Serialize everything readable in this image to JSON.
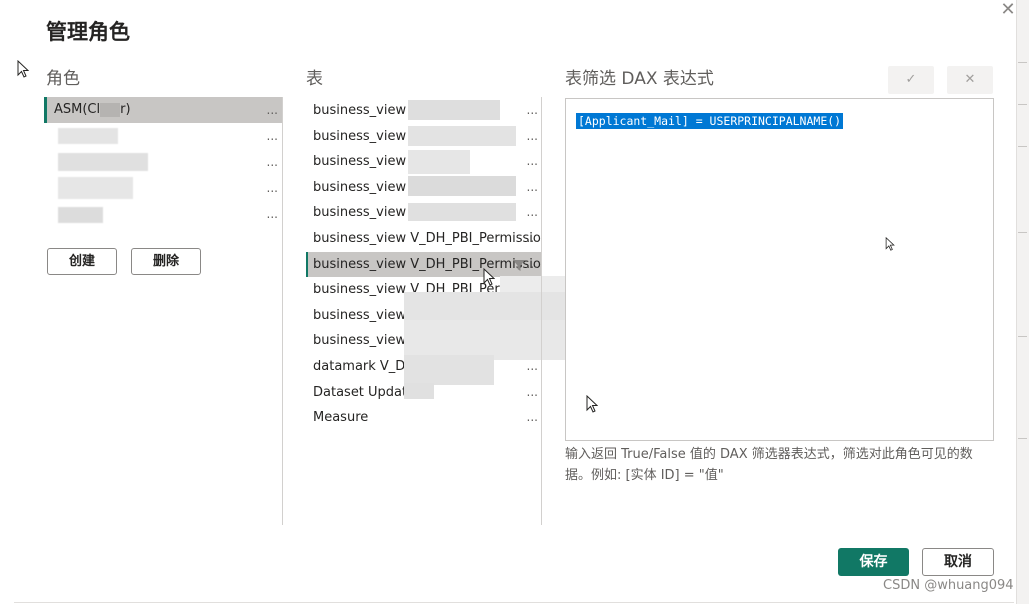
{
  "dialog": {
    "title": "管理角色",
    "close_glyph": "✕"
  },
  "roles": {
    "label": "角色",
    "items": [
      {
        "label": "ASM(Cl",
        "label_tail": "r)",
        "more": "..."
      },
      {
        "label": "",
        "more": "..."
      },
      {
        "label": "",
        "more": "..."
      },
      {
        "label": "",
        "more": "..."
      },
      {
        "label": "",
        "more": "..."
      }
    ],
    "create_label": "创建",
    "delete_label": "删除"
  },
  "tables": {
    "label": "表",
    "items": [
      {
        "label": "business_view V_",
        "more": "..."
      },
      {
        "label": "business_view V_",
        "more": "..."
      },
      {
        "label": "business_view V_",
        "more": "..."
      },
      {
        "label": "business_view V_",
        "more": "..."
      },
      {
        "label": "business_view V_",
        "more": "..."
      },
      {
        "label": "business_view V_DH_PBI_Permissio",
        "more": "..."
      },
      {
        "label": "business_view V_DH_PBI_Permissio",
        "more": "..."
      },
      {
        "label": "business_view V_DH_PBI_Perm",
        "more": "..."
      },
      {
        "label": "business_view V",
        "more": "..."
      },
      {
        "label": "business_view V",
        "more": "..."
      },
      {
        "label": "datamark V_DM",
        "more": "..."
      },
      {
        "label": "Dataset Update",
        "more": "..."
      },
      {
        "label": "Measure",
        "more": "..."
      }
    ],
    "selected_index": 6
  },
  "dax": {
    "label": "表筛选 DAX 表达式",
    "accept_glyph": "✓",
    "cancel_glyph": "✕",
    "expression": "[Applicant_Mail] = USERPRINCIPALNAME()",
    "help_line1": "输入返回 True/False 值的 DAX 筛选器表达式，筛选对此角色可见的数",
    "help_line2": "据。例如: [实体 ID] = \"值\""
  },
  "footer": {
    "save_label": "保存",
    "cancel_label": "取消"
  },
  "watermark": "CSDN @whuang094",
  "colors": {
    "accent": "#117865",
    "selection": "#c8c6c4",
    "text_highlight": "#0078d4"
  },
  "icons": {
    "filter": "filter-icon",
    "close": "close-icon",
    "check": "check-icon"
  }
}
